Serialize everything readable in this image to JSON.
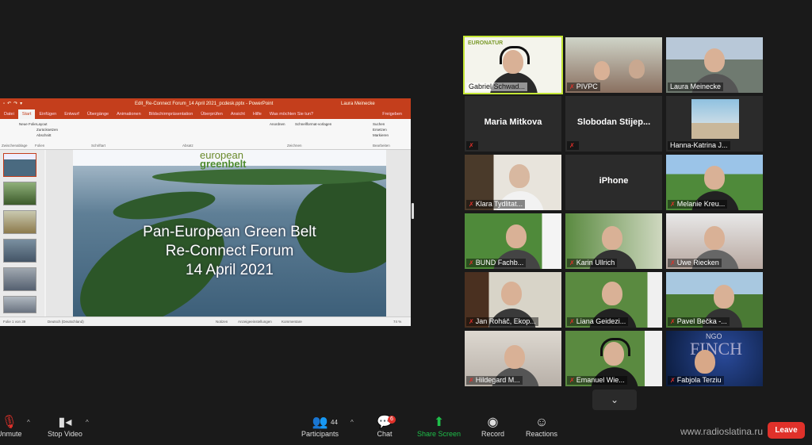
{
  "presentation": {
    "window_title": "Edit_Re-Connect Forum_14 April 2021_pcdesk.pptx - PowerPoint",
    "user": "Laura Meinecke",
    "tabs": [
      "Datei",
      "Start",
      "Einfügen",
      "Entwurf",
      "Übergänge",
      "Animationen",
      "Bildschirmpräsentation",
      "Überprüfen",
      "Ansicht",
      "Hilfe",
      "Was möchten Sie tun?"
    ],
    "share_label": "Freigeben",
    "ribbon_groups": [
      "Zwischenablage",
      "Folien",
      "Schriftart",
      "Absatz",
      "Zeichnen",
      "Bearbeiten"
    ],
    "ribbon_items": {
      "new_slide": "Neue Folie",
      "layout": "Layout",
      "reset": "Zurücksetzen",
      "section": "Abschnitt",
      "arrange": "Anordnen",
      "quick_styles": "Schnellformat-vorlagen",
      "find": "Suchen",
      "replace": "Ersetzen",
      "select": "Markieren"
    },
    "slide": {
      "logo_line1": "european",
      "logo_line2": "greenbelt",
      "title_line1": "Pan-European Green Belt",
      "title_line2": "Re-Connect Forum",
      "title_line3": "14 April 2021"
    },
    "status": {
      "slide_no": "Folie 1 von 39",
      "language": "Deutsch (Deutschland)",
      "notes": "Notizen",
      "display": "Anzeigeeinstellungen",
      "comments": "Kommentare",
      "zoom": "74 %"
    }
  },
  "participants_grid": [
    {
      "name": "Gabriel Schwad...",
      "muted": false,
      "speaking": true
    },
    {
      "name": "PIVPC",
      "muted": true
    },
    {
      "name": "Laura Meinecke",
      "muted": false
    },
    {
      "name": "Maria Mitkova",
      "muted": true,
      "no_video": true
    },
    {
      "name": "Slobodan  Stijep...",
      "muted": true,
      "no_video": true
    },
    {
      "name": "Hanna-Katrina J...",
      "muted": false
    },
    {
      "name": "Klara Tydlitat...",
      "muted": true
    },
    {
      "name": "iPhone",
      "muted": true,
      "no_video": true
    },
    {
      "name": "Melanie Kreu...",
      "muted": true
    },
    {
      "name": "BUND Fachb...",
      "muted": true
    },
    {
      "name": "Karin Ullrich",
      "muted": true
    },
    {
      "name": "Uwe Riecken",
      "muted": true
    },
    {
      "name": "Jan Roháč, Ekop...",
      "muted": true
    },
    {
      "name": "Liana Geidezi...",
      "muted": true
    },
    {
      "name": "Pavel Bečka -...",
      "muted": true
    },
    {
      "name": "Hildegard M...",
      "muted": true
    },
    {
      "name": "Emanuel Wie...",
      "muted": true
    },
    {
      "name": "Fabjola Terziu",
      "muted": true
    }
  ],
  "tile_overlays": {
    "euronatur": "EURONATUR",
    "ngo_line1": "NGO",
    "ngo_line2": "FINCH"
  },
  "toolbar": {
    "unmute": "Unmute",
    "stop_video": "Stop Video",
    "participants": "Participants",
    "participants_count": "44",
    "chat": "Chat",
    "chat_badge": "6",
    "share_screen": "Share Screen",
    "record": "Record",
    "reactions": "Reactions",
    "leave": "Leave"
  },
  "watermark": "www.radioslatina.ru",
  "colors": {
    "powerpoint": "#c43e1c",
    "active_speaker": "#c4e636",
    "share_green": "#1fbf4a",
    "leave_red": "#e0312a"
  }
}
